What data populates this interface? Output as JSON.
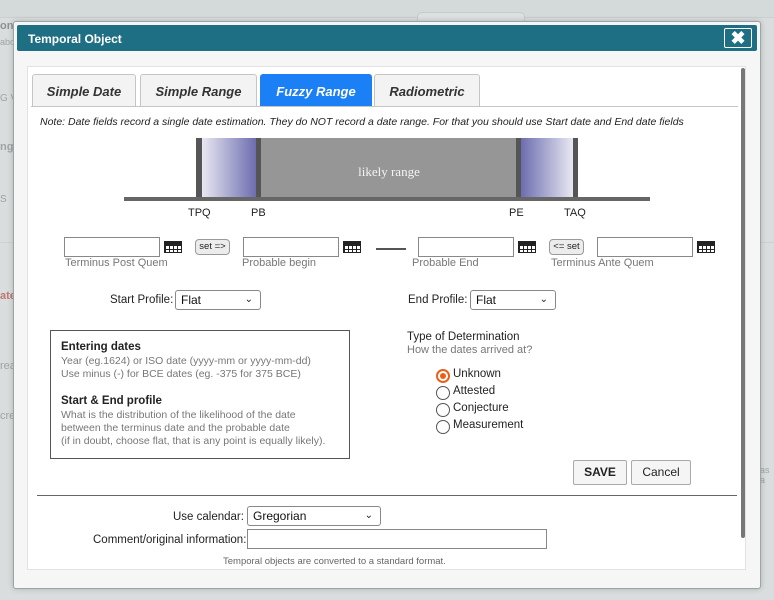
{
  "background": {
    "side_fragments": [
      "on",
      "abo",
      "G V",
      "ng",
      "S",
      "ate",
      "rea",
      "cre"
    ],
    "right_fragment": "as a"
  },
  "dialog": {
    "title": "Temporal Object",
    "close_glyph": "✖"
  },
  "tabs": [
    {
      "label": "Simple Date",
      "active": false
    },
    {
      "label": "Simple Range",
      "active": false
    },
    {
      "label": "Fuzzy Range",
      "active": true
    },
    {
      "label": "Radiometric",
      "active": false
    }
  ],
  "note": "Note: Date fields record a single date estimation. They do NOT record a date range. For that you should use Start date and End date fields",
  "diagram": {
    "center_label": "likely range",
    "labels": {
      "tpq": "TPQ",
      "pb": "PB",
      "pe": "PE",
      "taq": "TAQ"
    }
  },
  "date_fields": {
    "tpq": {
      "value": "",
      "label": "Terminus Post Quem"
    },
    "pb": {
      "value": "",
      "label": "Probable begin"
    },
    "pe": {
      "value": "",
      "label": "Probable End"
    },
    "taq": {
      "value": "",
      "label": "Terminus Ante Quem"
    },
    "set_forward_button": "set =>",
    "set_back_button": "<= set"
  },
  "profiles": {
    "start_label": "Start Profile:",
    "start_value": "Flat",
    "end_label": "End Profile:",
    "end_value": "Flat"
  },
  "info": {
    "h1": "Entering dates",
    "l1": "Year (eg.1624) or ISO date (yyyy-mm or yyyy-mm-dd)",
    "l2": "Use minus (-) for BCE dates (eg. -375 for 375 BCE)",
    "h2": "Start & End profile",
    "l3": "What is the distribution of the likelihood of the date",
    "l4": "between the terminus date and the probable date",
    "l5": "(if in doubt, choose flat, that is any point is equally likely)."
  },
  "determination": {
    "title": "Type of Determination",
    "subtitle": "How the dates arrived at?",
    "options": [
      {
        "label": "Unknown",
        "selected": true
      },
      {
        "label": "Attested",
        "selected": false
      },
      {
        "label": "Conjecture",
        "selected": false
      },
      {
        "label": "Measurement",
        "selected": false
      }
    ]
  },
  "actions": {
    "save": "SAVE",
    "cancel": "Cancel"
  },
  "calendar": {
    "label": "Use calendar:",
    "value": "Gregorian"
  },
  "comment": {
    "label": "Comment/original information:",
    "value": ""
  },
  "footnote": "Temporal objects are converted to a standard format.",
  "colors": {
    "titlebar": "#1e6f84",
    "active_tab": "#1b7ff5",
    "radio_selected": "#e8601a"
  }
}
